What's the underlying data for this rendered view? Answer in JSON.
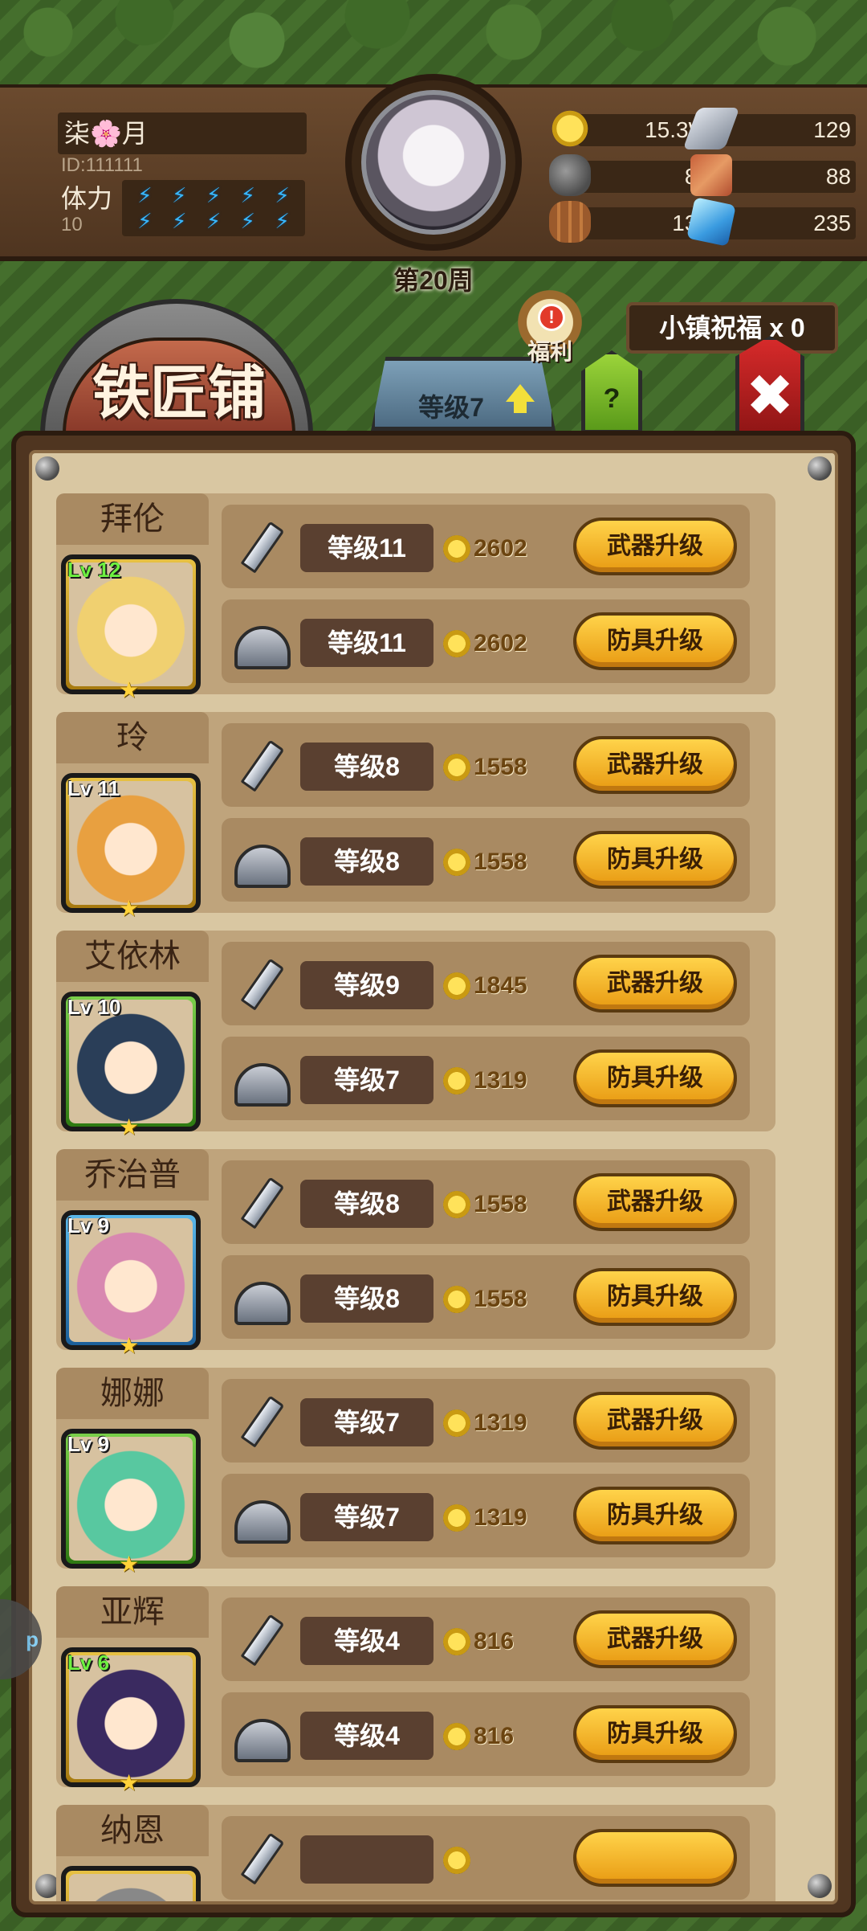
{
  "player": {
    "name": "柒🌸月",
    "id": "ID:111111",
    "stamina_label": "体力",
    "stamina_value": "10",
    "stamina_bolts": 10
  },
  "week": "第20周",
  "resources": [
    {
      "icon": "coin-icon",
      "value": "15.3W"
    },
    {
      "icon": "iron-ingot-icon",
      "value": "129"
    },
    {
      "icon": "stone-icon",
      "value": "83"
    },
    {
      "icon": "hide-icon",
      "value": "88"
    },
    {
      "icon": "wood-log-icon",
      "value": "133"
    },
    {
      "icon": "crystal-icon",
      "value": "235"
    }
  ],
  "shop": {
    "title": "铁匠铺",
    "level_tab": "等级7",
    "help": "?",
    "welfare": "福利",
    "welfare_badge": "!",
    "blessing": "小镇祝福 x 0",
    "close": "✖"
  },
  "heroes": [
    {
      "name": "拜伦",
      "lv": "Lv 12",
      "lv_color": "green",
      "frame": "gold",
      "hair": "#f0d070",
      "weapon": {
        "level": "等级11",
        "cost": "2602",
        "button": "武器升级"
      },
      "armor": {
        "level": "等级11",
        "cost": "2602",
        "button": "防具升级"
      }
    },
    {
      "name": "玲",
      "lv": "Lv 11",
      "lv_color": "white",
      "frame": "gold",
      "hair": "#e8a040",
      "weapon": {
        "level": "等级8",
        "cost": "1558",
        "button": "武器升级"
      },
      "armor": {
        "level": "等级8",
        "cost": "1558",
        "button": "防具升级"
      }
    },
    {
      "name": "艾依林",
      "lv": "Lv 10",
      "lv_color": "white",
      "frame": "green",
      "hair": "#2a3e58",
      "weapon": {
        "level": "等级9",
        "cost": "1845",
        "button": "武器升级"
      },
      "armor": {
        "level": "等级7",
        "cost": "1319",
        "button": "防具升级"
      }
    },
    {
      "name": "乔治普",
      "lv": "Lv 9",
      "lv_color": "white",
      "frame": "blue",
      "hair": "#d888b0",
      "weapon": {
        "level": "等级8",
        "cost": "1558",
        "button": "武器升级"
      },
      "armor": {
        "level": "等级8",
        "cost": "1558",
        "button": "防具升级"
      }
    },
    {
      "name": "娜娜",
      "lv": "Lv 9",
      "lv_color": "white",
      "frame": "green",
      "hair": "#58c8a0",
      "weapon": {
        "level": "等级7",
        "cost": "1319",
        "button": "武器升级"
      },
      "armor": {
        "level": "等级7",
        "cost": "1319",
        "button": "防具升级"
      }
    },
    {
      "name": "亚辉",
      "lv": "Lv 6",
      "lv_color": "green",
      "frame": "gold",
      "hair": "#3a2a60",
      "weapon": {
        "level": "等级4",
        "cost": "816",
        "button": "武器升级"
      },
      "armor": {
        "level": "等级4",
        "cost": "816",
        "button": "防具升级"
      }
    },
    {
      "name": "纳恩",
      "lv": "",
      "lv_color": "white",
      "frame": "gold",
      "hair": "#888888",
      "weapon": {
        "level": "",
        "cost": "",
        "button": ""
      },
      "armor": {
        "level": "",
        "cost": "",
        "button": ""
      }
    }
  ],
  "side_tab": "p"
}
